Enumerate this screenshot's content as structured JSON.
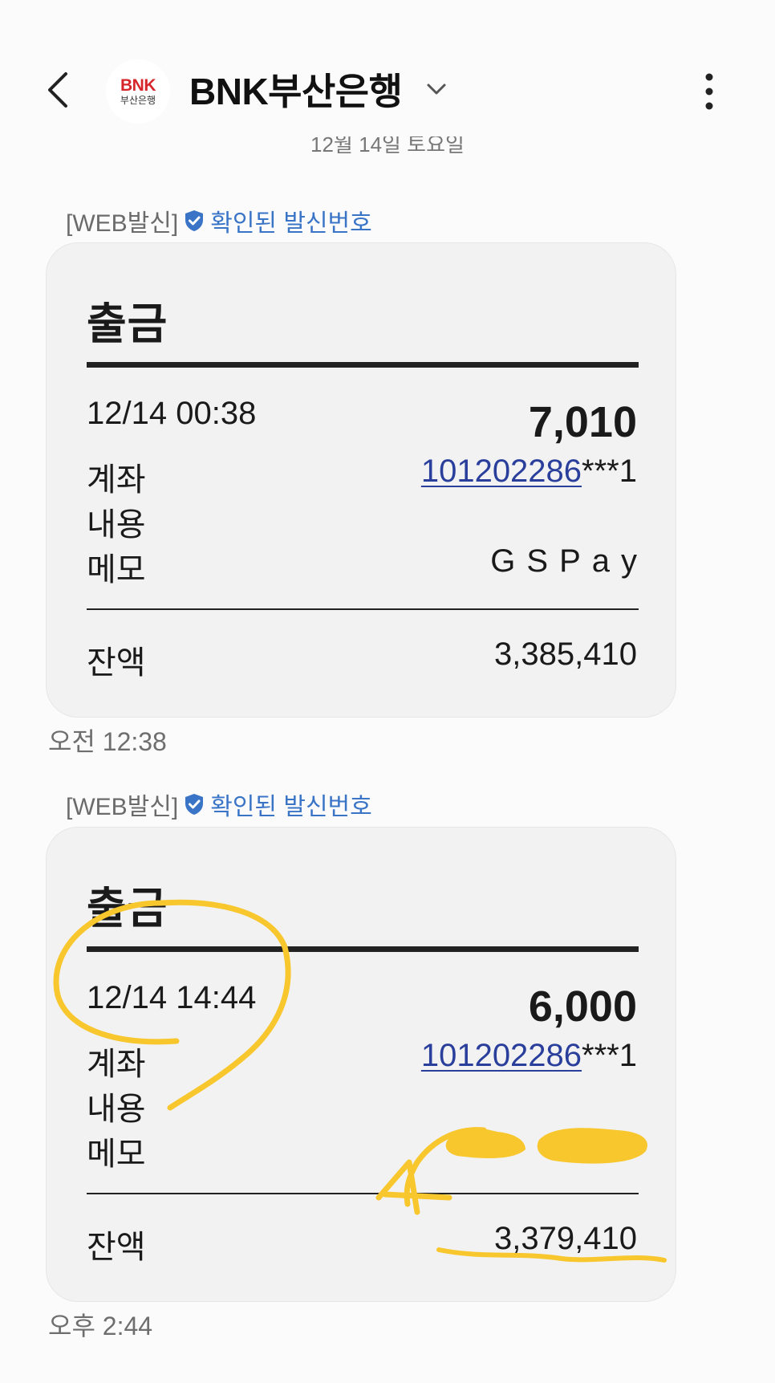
{
  "header": {
    "title": "BNK부산은행",
    "logo_top": "BNK",
    "logo_bottom": "부산은행",
    "date_separator": "12월 14일 토요일"
  },
  "messages": [
    {
      "sender_tag": "[WEB발신]",
      "verified_label": "확인된 발신번호",
      "heading": "출금",
      "datetime": "12/14 00:38",
      "amount": "7,010",
      "account_label": "계좌",
      "account_number": "101202286",
      "account_suffix": "***1",
      "content_label": "내용",
      "memo_label": "메모",
      "memo_value": "GSPay",
      "balance_label": "잔액",
      "balance_value": "3,385,410",
      "timestamp": "오전 12:38"
    },
    {
      "sender_tag": "[WEB발신]",
      "verified_label": "확인된 발신번호",
      "heading": "출금",
      "datetime": "12/14 14:44",
      "amount": "6,000",
      "account_label": "계좌",
      "account_number": "101202286",
      "account_suffix": "***1",
      "content_label": "내용",
      "memo_label": "메모",
      "balance_label": "잔액",
      "balance_value": "3,379,410",
      "timestamp": "오후 2:44"
    }
  ],
  "colors": {
    "background": "#fbfbfb",
    "card": "#f2f2f2",
    "verified_blue": "#3a74c7",
    "link_blue": "#2a3f9c",
    "annotation_yellow": "#f8c62d",
    "logo_red": "#d6262c"
  },
  "icons": {
    "back": "back-arrow-icon",
    "dropdown": "chevron-down-icon",
    "more": "more-vertical-icon",
    "verified": "verified-shield-icon"
  }
}
